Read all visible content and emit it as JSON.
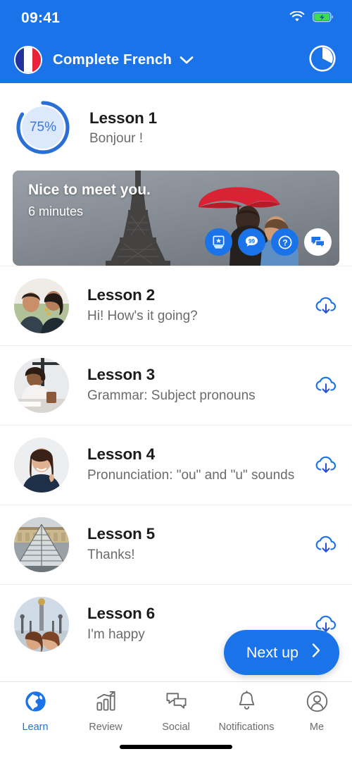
{
  "colors": {
    "brand_blue": "#1a73e8",
    "ring_track": "#dce9fa",
    "text_dark": "#1b1b1b",
    "text_muted": "#6b6b6b",
    "battery_green": "#3ddc50"
  },
  "status_bar": {
    "time": "09:41",
    "wifi_icon": "wifi-icon",
    "battery_icon": "battery-charging-icon"
  },
  "header": {
    "flag_icon": "french-flag-icon",
    "course_title": "Complete French",
    "dropdown_icon": "chevron-down-icon",
    "progress_icon": "pie-progress-icon"
  },
  "current_lesson": {
    "progress_percent": "75%",
    "progress_value": 75,
    "title": "Lesson 1",
    "subtitle": "Bonjour !"
  },
  "hero_card": {
    "title": "Nice to meet you.",
    "duration": "6 minutes",
    "image_description": "eiffel-tower-couple-red-umbrella",
    "actions": [
      {
        "name": "vocabulary-book-icon",
        "label": "Vocabulary"
      },
      {
        "name": "phrases-99-icon",
        "label": "Phrases"
      },
      {
        "name": "quiz-question-icon",
        "label": "Quiz"
      },
      {
        "name": "conversation-chat-icon",
        "label": "Conversation"
      }
    ]
  },
  "lessons": [
    {
      "title": "Lesson 2",
      "subtitle": "Hi! How's it going?",
      "thumb": "couple-laughing-thumb",
      "download_icon": "cloud-download-icon"
    },
    {
      "title": "Lesson 3",
      "subtitle": "Grammar: Subject pronouns",
      "thumb": "woman-studying-desk-thumb",
      "download_icon": "cloud-download-icon"
    },
    {
      "title": "Lesson 4",
      "subtitle": "Pronunciation: \"ou\" and \"u\" sounds",
      "thumb": "woman-pointing-cheek-thumb",
      "download_icon": "cloud-download-icon"
    },
    {
      "title": "Lesson 5",
      "subtitle": "Thanks!",
      "thumb": "louvre-pyramid-thumb",
      "download_icon": "cloud-download-icon"
    },
    {
      "title": "Lesson 6",
      "subtitle": "I'm happy",
      "thumb": "two-women-paris-bridge-thumb",
      "download_icon": "cloud-download-icon"
    }
  ],
  "next_up": {
    "label": "Next up",
    "icon": "chevron-right-icon"
  },
  "tab_bar": {
    "active_index": 0,
    "tabs": [
      {
        "label": "Learn",
        "icon": "globe-icon"
      },
      {
        "label": "Review",
        "icon": "bar-chart-arrow-icon"
      },
      {
        "label": "Social",
        "icon": "chat-bubbles-icon"
      },
      {
        "label": "Notifications",
        "icon": "bell-icon"
      },
      {
        "label": "Me",
        "icon": "person-circle-icon"
      }
    ]
  }
}
